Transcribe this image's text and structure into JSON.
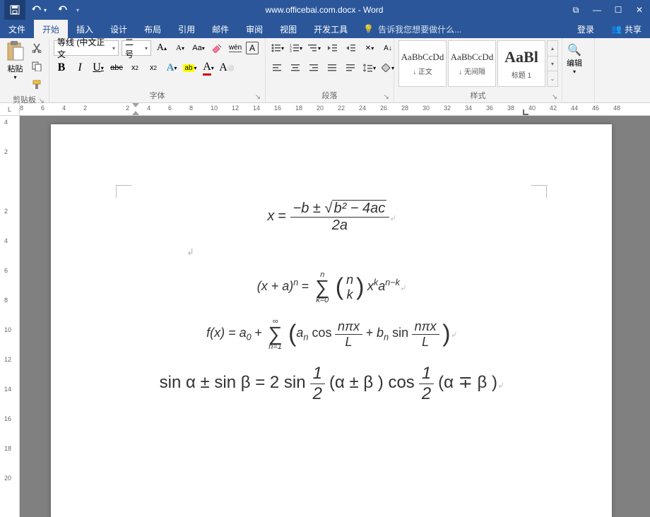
{
  "title": "www.officebai.com.docx - Word",
  "qat": {
    "save": "save-icon",
    "undo": "undo-icon",
    "redo": "redo-icon"
  },
  "window": {
    "ribbon_opts": "⧉",
    "min": "—",
    "max": "☐",
    "close": "✕"
  },
  "tabs": {
    "file": "文件",
    "items": [
      "开始",
      "插入",
      "设计",
      "布局",
      "引用",
      "邮件",
      "审阅",
      "视图",
      "开发工具"
    ],
    "active_index": 0,
    "tell_me": "告诉我您想要做什么...",
    "signin": "登录",
    "share": "共享"
  },
  "ribbon": {
    "clipboard": {
      "paste": "粘贴",
      "label": "剪贴板"
    },
    "font": {
      "family": "等线 (中文正文",
      "size": "二号",
      "label": "字体",
      "buttons": {
        "grow": "A",
        "shrink": "A",
        "case": "Aa",
        "clear": "✎",
        "phonetic": "wén",
        "charborder": "A",
        "bold": "B",
        "italic": "I",
        "underline": "U",
        "strike": "abc",
        "sub": "x₂",
        "sup": "x²",
        "texteffect": "A",
        "highlight": "ab",
        "fontcolor": "A"
      }
    },
    "paragraph": {
      "label": "段落"
    },
    "styles": {
      "label": "样式",
      "items": [
        {
          "preview": "AaBbCcDd",
          "name": "↓ 正文"
        },
        {
          "preview": "AaBbCcDd",
          "name": "↓ 无间隔"
        },
        {
          "preview": "AaBl",
          "name": "标题 1"
        }
      ]
    },
    "editing": {
      "label": "编辑",
      "find": "🔍"
    }
  },
  "ruler": {
    "corner": "L",
    "h_ticks": [
      "8",
      "6",
      "4",
      "2",
      "",
      "2",
      "4",
      "6",
      "8",
      "10",
      "12",
      "14",
      "16",
      "18",
      "20",
      "22",
      "24",
      "26",
      "28",
      "30",
      "32",
      "34",
      "36",
      "38",
      "40",
      "42",
      "44",
      "46",
      "48"
    ],
    "v_ticks": [
      "4",
      "2",
      "",
      "2",
      "4",
      "6",
      "8",
      "10",
      "12",
      "14",
      "16",
      "18",
      "20"
    ]
  },
  "equations": {
    "eq1": {
      "lhs": "x",
      "eq": "=",
      "num_a": "−b ±",
      "rad": "√",
      "disc": "b² − 4ac",
      "den": "2a"
    },
    "eq2": {
      "lhs": "(x + a)",
      "exp_n": "n",
      "eq": "=",
      "sum_top": "n",
      "sum_bot": "k=0",
      "binom_top": "n",
      "binom_bot": "k",
      "term": "x",
      "k": "k",
      "a": "a",
      "nmk": "n−k"
    },
    "eq3": {
      "lhs": "f(x) = a",
      "a0sub": "0",
      "plus": " + ",
      "sum_top": "∞",
      "sum_bot": "n=1",
      "an": "a",
      "ansub": "n",
      "cos": " cos",
      "num": "nπx",
      "den": "L",
      "plus2": " + b",
      "bnsub": "n",
      "sin": " sin"
    },
    "eq4": {
      "text1": "sin α ± sin β = 2 sin",
      "half1_num": "1",
      "half1_den": "2",
      "mid": " (α ± β ) cos",
      "half2_num": "1",
      "half2_den": "2",
      "end": " (α ∓ β )"
    }
  }
}
